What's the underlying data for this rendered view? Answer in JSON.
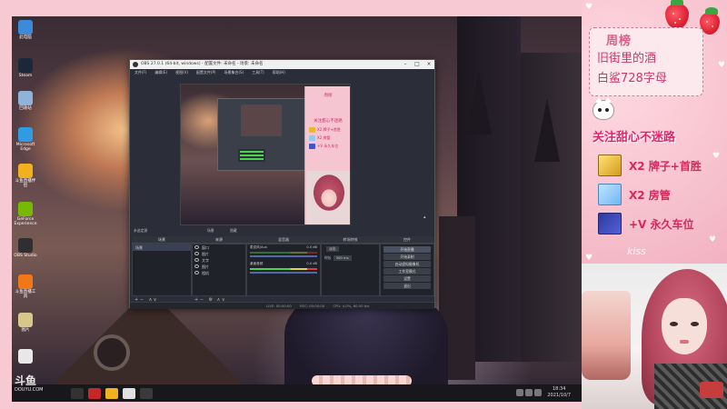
{
  "desktop": {
    "icons": [
      {
        "label": "此电脑",
        "color": "#3c8ad8"
      },
      {
        "label": "Steam",
        "color": "#1b2838"
      },
      {
        "label": "回收站",
        "color": "#8fb3d9"
      },
      {
        "label": "Microsoft Edge",
        "color": "#2f9be0"
      },
      {
        "label": "斗鱼直播伴侣",
        "color": "#f0b020"
      },
      {
        "label": "GeForce Experience",
        "color": "#76b900"
      },
      {
        "label": "OBS Studio",
        "color": "#302e31"
      },
      {
        "label": "斗鱼直播工具",
        "color": "#f07818"
      },
      {
        "label": "图片",
        "color": "#d7c78a"
      },
      {
        "label": "",
        "color": "#e8e8e8"
      }
    ]
  },
  "watermark": {
    "brand": "斗鱼",
    "url": "DOUYU.COM"
  },
  "taskbar": {
    "clock_time": "18:34",
    "clock_date": "2021/10/7",
    "apps": [
      "#333",
      "#c62828",
      "#f0b020",
      "#e0e0e0",
      "#3a3a3a"
    ]
  },
  "obs": {
    "title": "OBS 27.0.1 (64-bit, windows) - 配置文件: 未命名 - 场景: 未命名",
    "menu": [
      "文件(F)",
      "编辑(E)",
      "视图(V)",
      "配置文件(P)",
      "场景集合(S)",
      "工具(T)",
      "帮助(H)"
    ],
    "preview_btn_left": "场景",
    "preview_btn_right": "隐藏",
    "scene_label": "未选定源",
    "docks": {
      "scenes": {
        "title": "场景",
        "items": [
          "场景"
        ]
      },
      "sources": {
        "title": "来源",
        "items": [
          "窗口",
          "图片",
          "文字",
          "图片",
          "相机"
        ]
      },
      "mixer": {
        "title": "混音器",
        "channels": [
          {
            "name": "麦克风/Aux",
            "level": "0.0 dB"
          },
          {
            "name": "桌面音频",
            "level": "0.0 dB"
          }
        ]
      },
      "transitions": {
        "title": "转场特效",
        "type": "淡出",
        "duration_label": "时长",
        "duration": "300 ms"
      },
      "controls": {
        "title": "控件",
        "buttons": [
          "开始直播",
          "开始录制",
          "启动虚拟摄像机",
          "工作室模式",
          "设置",
          "退出"
        ]
      }
    },
    "footer_icons": [
      "+ −",
      "∧ ∨"
    ],
    "status": {
      "live": "LIVE: 00:00:00",
      "rec": "REC: 00:00:00",
      "cpu": "CPU: 4.0%, 60.00 fps"
    },
    "preview_overlay": {
      "title": "周榜",
      "follow": "关注甜心不迷路",
      "rows": [
        "X2 牌子+首胜",
        "X2 房管",
        "+V 永久车位"
      ]
    }
  },
  "overlay": {
    "board_title": "周榜",
    "board_lines": [
      "旧街里的酒",
      "白鲨728字母"
    ],
    "follow_text": "关注甜心不迷路",
    "gifts": [
      {
        "icon": "gold-bar-icon",
        "text": "X2 牌子+首胜"
      },
      {
        "icon": "paper-plane-icon",
        "text": "X2 房管"
      },
      {
        "icon": "rocket-icon",
        "text": "+V 永久车位"
      }
    ],
    "kiss_text": "kiss",
    "colors": {
      "accent": "#e0246a",
      "panel": "#f7c3cf"
    }
  }
}
